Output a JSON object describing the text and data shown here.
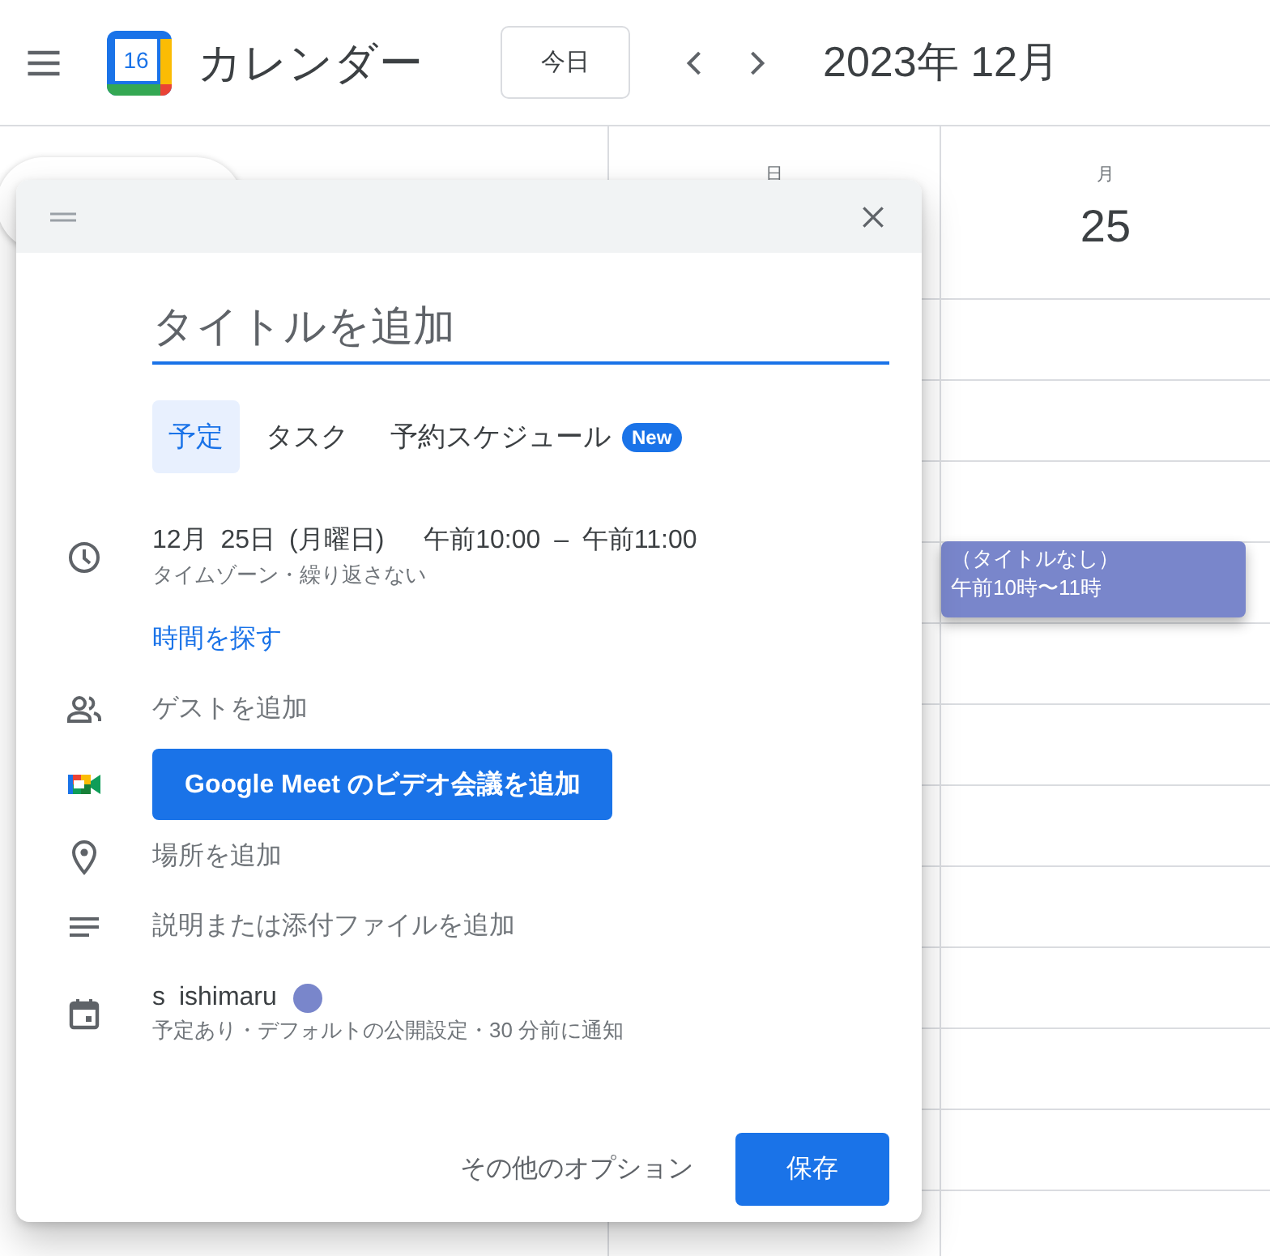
{
  "header": {
    "logo_day": "16",
    "app_name": "カレンダー",
    "today_button": "今日",
    "month": "2023年 12月"
  },
  "days": [
    {
      "weekday": "日"
    },
    {
      "weekday": "月",
      "date": "25"
    }
  ],
  "event_chip": {
    "title": "（タイトルなし）",
    "time": "午前10時〜11時",
    "color": "#7986cb"
  },
  "dialog": {
    "title_placeholder": "タイトルを追加",
    "tabs": [
      {
        "label": "予定",
        "selected": true
      },
      {
        "label": "タスク",
        "selected": false
      },
      {
        "label": "予約スケジュール",
        "selected": false,
        "badge": "New"
      }
    ],
    "rows": [
      {
        "kind": "datetime",
        "date": "12月 25日 (月曜日)",
        "start": "午前10:00",
        "separator": "–",
        "end": "午前11:00",
        "detail": "タイムゾーン・繰り返さない"
      },
      {
        "kind": "link",
        "text": "時間を探す"
      },
      {
        "kind": "guests",
        "text": "ゲストを追加"
      },
      {
        "kind": "meet",
        "text": "Google Meet のビデオ会議を追加"
      },
      {
        "kind": "location",
        "text": "場所を追加"
      },
      {
        "kind": "description",
        "text": "説明または添付ファイルを追加"
      },
      {
        "kind": "calendar",
        "text": "s ishimaru",
        "color": "#7986cb",
        "detail": "予定あり・デフォルトの公開設定・30 分前に通知"
      }
    ],
    "more_options": "その他のオプション",
    "save_button": "保存"
  }
}
